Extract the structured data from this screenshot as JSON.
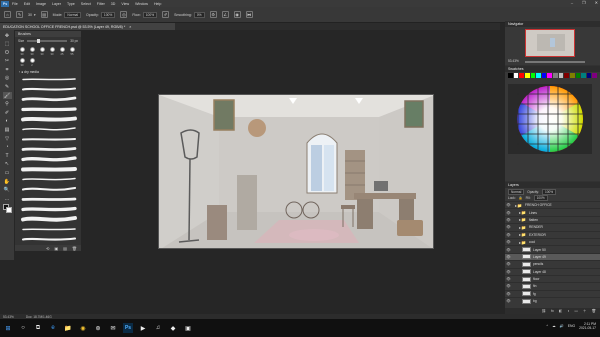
{
  "app": {
    "menu": [
      "File",
      "Edit",
      "Image",
      "Layer",
      "Type",
      "Select",
      "Filter",
      "3D",
      "View",
      "Window",
      "Help"
    ],
    "window_controls": [
      "–",
      "❐",
      "✕"
    ],
    "logo_text": "Ps"
  },
  "options_bar": {
    "mode_label": "Mode:",
    "mode_value": "Normal",
    "opacity_label": "Opacity:",
    "opacity_value": "100%",
    "flow_label": "Flow:",
    "flow_value": "100%",
    "smoothing_label": "Smoothing:",
    "smoothing_value": "0%",
    "brush_size": "30"
  },
  "document": {
    "tab_title": "EDUCATION SCHOOL OFFICE FRENCH.psd @ 53.5% (Layer 49, RGB/8) *",
    "tab_close": "×"
  },
  "tools": [
    "✥",
    "⬚",
    "ʘ",
    "✂",
    "⌗",
    "◎",
    "✎",
    "🖌",
    "⚲",
    "✐",
    "◐",
    "▤",
    "▽",
    "◔",
    "T",
    "↖",
    "▭",
    "✋",
    "🔍",
    "…",
    "■"
  ],
  "brushes_panel": {
    "title": "Brushes",
    "size_label": "Size",
    "size_value": "30 px",
    "tips": [
      {
        "label": "30"
      },
      {
        "label": "30"
      },
      {
        "label": "30"
      },
      {
        "label": "30"
      },
      {
        "label": "25"
      },
      {
        "label": "55"
      },
      {
        "label": "30"
      },
      {
        "label": "2"
      }
    ],
    "group_name": "› ● dry media",
    "strokes": 17,
    "footer_icons": [
      "⟲",
      "▣",
      "▤",
      "🗑"
    ]
  },
  "canvas": {
    "description_free": true
  },
  "navigator": {
    "title": "Navigator",
    "zoom": "53.43%"
  },
  "swatches": {
    "title": "Swatches",
    "colors": [
      "#000000",
      "#ffffff",
      "#ff0000",
      "#ffff00",
      "#00ff00",
      "#00ffff",
      "#0000ff",
      "#ff00ff",
      "#808080",
      "#c0c0c0",
      "#800000",
      "#808000",
      "#008000",
      "#008080",
      "#000080",
      "#800080"
    ]
  },
  "layers": {
    "title": "Layers",
    "blend_mode": "Normal",
    "opacity_label": "Opacity:",
    "opacity_value": "100%",
    "fill_label": "Fill:",
    "fill_value": "100%",
    "lock_label": "Lock:",
    "items": [
      {
        "name": "FRENCH OFFICE",
        "kind": "group",
        "indent": 0
      },
      {
        "name": "Lines",
        "kind": "group",
        "indent": 1
      },
      {
        "name": "flatten",
        "kind": "group",
        "indent": 1
      },
      {
        "name": "RENDER",
        "kind": "group",
        "indent": 1
      },
      {
        "name": "EXTERIOR",
        "kind": "group",
        "indent": 1
      },
      {
        "name": "cool",
        "kind": "group",
        "indent": 1
      },
      {
        "name": "Layer 50",
        "kind": "layer",
        "indent": 2
      },
      {
        "name": "Layer 49",
        "kind": "layer",
        "indent": 2,
        "selected": true
      },
      {
        "name": "pencils",
        "kind": "layer",
        "indent": 2
      },
      {
        "name": "Layer 48",
        "kind": "layer",
        "indent": 2
      },
      {
        "name": "floor",
        "kind": "layer",
        "indent": 2
      },
      {
        "name": "fin",
        "kind": "layer",
        "indent": 2
      },
      {
        "name": "fg",
        "kind": "layer",
        "indent": 2
      },
      {
        "name": "bg",
        "kind": "layer",
        "indent": 2
      }
    ],
    "footer_icons": [
      "⛓",
      "fx",
      "◧",
      "◑",
      "▭",
      "＋",
      "🗑"
    ]
  },
  "status": {
    "zoom": "53.43%",
    "doc": "Doc: 18.7M/1.46G"
  },
  "taskbar": {
    "search_placeholder": "",
    "apps": [
      "⊞",
      "○",
      "⧉",
      "e",
      "📁",
      "◉",
      "⊛",
      "✉",
      "Ps",
      "▶",
      "♫",
      "◆",
      "▣"
    ],
    "tray_icons": [
      "^",
      "☁",
      "🔊",
      "ENG"
    ],
    "time": "2:11 PM",
    "date": "2021-05-17"
  }
}
